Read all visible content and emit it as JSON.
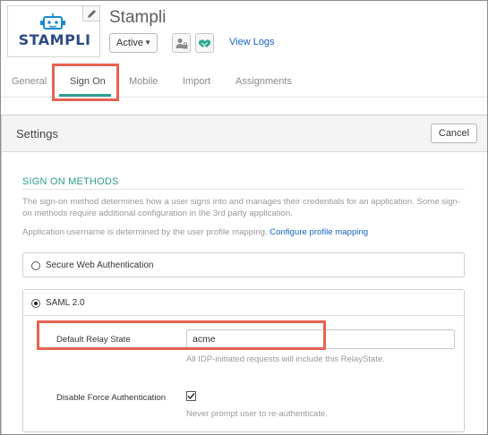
{
  "app": {
    "logo_text": "STAMPLI",
    "title": "Stampli",
    "status": "Active",
    "view_logs": "View Logs"
  },
  "tabs": [
    {
      "label": "General"
    },
    {
      "label": "Sign On"
    },
    {
      "label": "Mobile"
    },
    {
      "label": "Import"
    },
    {
      "label": "Assignments"
    }
  ],
  "settings": {
    "title": "Settings",
    "cancel_label": "Cancel"
  },
  "sign_on": {
    "section_title": "SIGN ON METHODS",
    "description": "The sign-on method determines how a user signs into and manages their credentials for an application. Some sign-on methods require additional configuration in the 3rd party application.",
    "mapping_text": "Application username is determined by the user profile mapping.",
    "mapping_link": "Configure profile mapping",
    "methods": [
      {
        "label": "Secure Web Authentication",
        "selected": false
      },
      {
        "label": "SAML 2.0",
        "selected": true
      }
    ],
    "relay_state": {
      "label": "Default Relay State",
      "value": "acme",
      "hint": "All IDP-initiated requests will include this RelayState."
    },
    "force_auth": {
      "label": "Disable Force Authentication",
      "checked": true,
      "hint": "Never prompt user to re-authenticate."
    }
  },
  "colors": {
    "accent": "#29a38e",
    "link": "#1662c4",
    "highlight": "#e66251"
  }
}
